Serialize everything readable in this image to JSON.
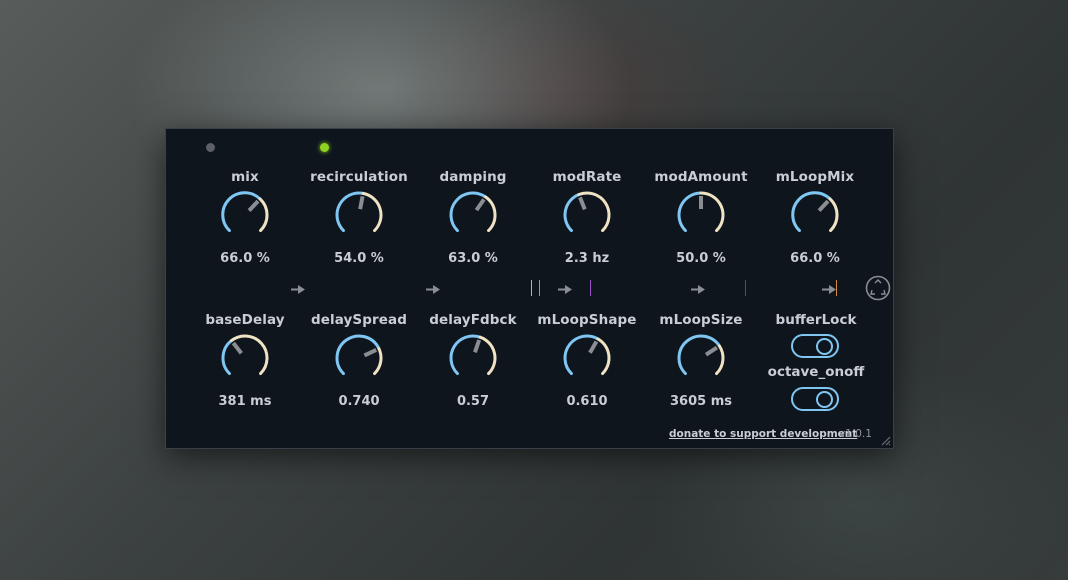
{
  "knobs_row1": [
    {
      "label": "mix",
      "value": "66.0 %",
      "fraction": 0.66
    },
    {
      "label": "recirculation",
      "value": "54.0 %",
      "fraction": 0.54
    },
    {
      "label": "damping",
      "value": "63.0 %",
      "fraction": 0.63
    },
    {
      "label": "modRate",
      "value": "2.3 hz",
      "fraction": 0.42
    },
    {
      "label": "modAmount",
      "value": "50.0 %",
      "fraction": 0.5
    },
    {
      "label": "mLoopMix",
      "value": "66.0 %",
      "fraction": 0.66
    }
  ],
  "knobs_row2": [
    {
      "label": "baseDelay",
      "value": "381 ms",
      "fraction": 0.36
    },
    {
      "label": "delaySpread",
      "value": "0.740",
      "fraction": 0.74
    },
    {
      "label": "delayFdbck",
      "value": "0.57",
      "fraction": 0.57
    },
    {
      "label": "mLoopShape",
      "value": "0.610",
      "fraction": 0.61
    },
    {
      "label": "mLoopSize",
      "value": "3605 ms",
      "fraction": 0.71
    }
  ],
  "toggles": {
    "bufferLock": {
      "label": "bufferLock",
      "on": true
    },
    "octave_onoff": {
      "label": "octave_onoff",
      "on": true
    }
  },
  "footer": {
    "donate_label": "donate to support development",
    "version": "v1.0.1"
  },
  "icons": {
    "status_led_1": "status-led-off",
    "status_led_2": "status-led-on",
    "recycle": "recycle-icon",
    "flow_arrow": "arrow-right-icon",
    "resize": "resize-grip-icon"
  },
  "colors": {
    "panel_bg": "#0e151d",
    "arc_active": "#7fc6f2",
    "arc_inactive": "#efe3c4",
    "pointer": "#8a8e93",
    "text": "#c9ced4",
    "led_on": "#8fd21f"
  }
}
